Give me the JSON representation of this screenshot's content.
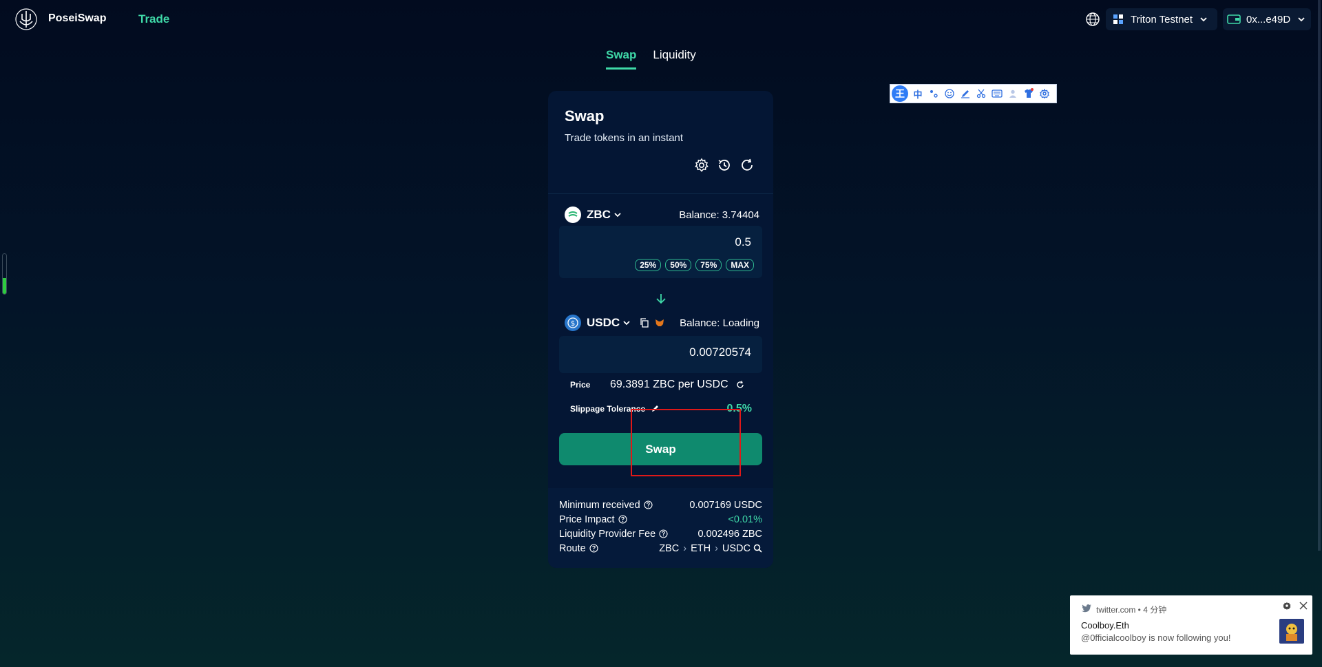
{
  "header": {
    "brand": "PoseiSwap",
    "nav_trade": "Trade",
    "network": "Triton Testnet",
    "wallet": "0x...e49D"
  },
  "tabs": [
    {
      "label": "Swap",
      "active": true
    },
    {
      "label": "Liquidity",
      "active": false
    }
  ],
  "card": {
    "title": "Swap",
    "subtitle": "Trade tokens in an instant"
  },
  "from": {
    "token": "ZBC",
    "balance": "Balance: 3.74404",
    "amount": "0.5",
    "percent_buttons": [
      "25%",
      "50%",
      "75%",
      "MAX"
    ]
  },
  "to": {
    "token": "USDC",
    "balance": "Balance: Loading",
    "amount": "0.00720574"
  },
  "price": {
    "label": "Price",
    "value": "69.3891 ZBC per USDC"
  },
  "slippage": {
    "label": "Slippage Tolerance",
    "value": "0.5%"
  },
  "swap_button": "Swap",
  "details": {
    "min_received_label": "Minimum received",
    "min_received_value": "0.007169 USDC",
    "price_impact_label": "Price Impact",
    "price_impact_value": "<0.01%",
    "lp_fee_label": "Liquidity Provider Fee",
    "lp_fee_value": "0.002496 ZBC",
    "route_label": "Route",
    "route": [
      "ZBC",
      "ETH",
      "USDC"
    ]
  },
  "ime_toolbar": {
    "main": "王",
    "items": [
      "中"
    ]
  },
  "notification": {
    "source": "twitter.com • 4 分钟",
    "title": "Coolboy.Eth",
    "body": "@0fficialcoolboy is now following you!"
  },
  "colors": {
    "accent": "#3fd9a8",
    "button": "#0f8a6e",
    "card": "#041634",
    "highlight": "#e01818"
  }
}
